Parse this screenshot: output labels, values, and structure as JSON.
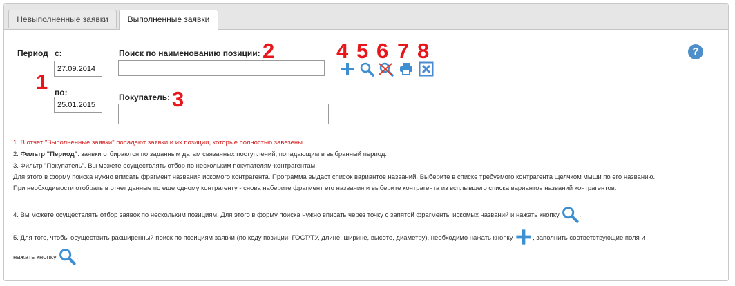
{
  "tabs": [
    {
      "label": "Невыполненные заявки"
    },
    {
      "label": "Выполненные заявки"
    }
  ],
  "filters": {
    "period_label": "Период",
    "from_label": "с:",
    "from_value": "27.09.2014",
    "to_label": "по:",
    "to_value": "25.01.2015",
    "search_label": "Поиск по наименованию позиции:",
    "search_value": "",
    "buyer_label": "Покупатель:",
    "buyer_value": ""
  },
  "markers": [
    "1",
    "2",
    "3",
    "4",
    "5",
    "6",
    "7",
    "8"
  ],
  "toolbar_icons": [
    "plus-icon",
    "search-icon",
    "clear-search-icon",
    "print-icon",
    "excel-icon"
  ],
  "help_label": "?",
  "notes": {
    "n1": "1. В отчет \"Выполненные заявки\" попадают заявки и их позиции, которые полностью завезены.",
    "n2_prefix": "2. ",
    "n2_bold": "Фильтр \"Период\"",
    "n2_rest": ": заявки отбираются по заданным датам связанных поступлений, попадающим в выбранный период.",
    "n3": "3. Фильтр \"Покупатель\". Вы можете осуществлять отбор по нескольким покупателям-контрагентам.",
    "n3b": "Для этого в форму поиска нужно вписать фрагмент названия искомого контрагента. Программа выдаст список вариантов названий. Выберите в списке требуемого контрагента щелчком мыши по его названию.",
    "n3c": "При необходимости отобрать в отчет данные по еще одному контрагенту - снова наберите фрагмент его названия и выберите контрагента из всплывшего списка вариантов названий контрагентов.",
    "n4": "4. Вы можете осуществлять отбор заявок по нескольким позициям. Для этого в форму поиска нужно вписать через точку с запятой фрагменты искомых названий и нажать кнопку",
    "n4_end": ".",
    "n5": "5. Для того, чтобы осуществить расширенный поиск по позициям заявки (по коду позиции, ГОСТ/ТУ, длине, ширине, высоте, диаметру), необходимо нажать кнопку",
    "n5_mid": ", заполнить соответствующие поля и",
    "n5b": "нажать кнопку",
    "n5b_end": "."
  },
  "colors": {
    "accent_blue": "#3d8fd1",
    "marker_red": "#e8151b",
    "excel_blue": "#4a8ad0",
    "help_blue": "#4f8fc9"
  }
}
